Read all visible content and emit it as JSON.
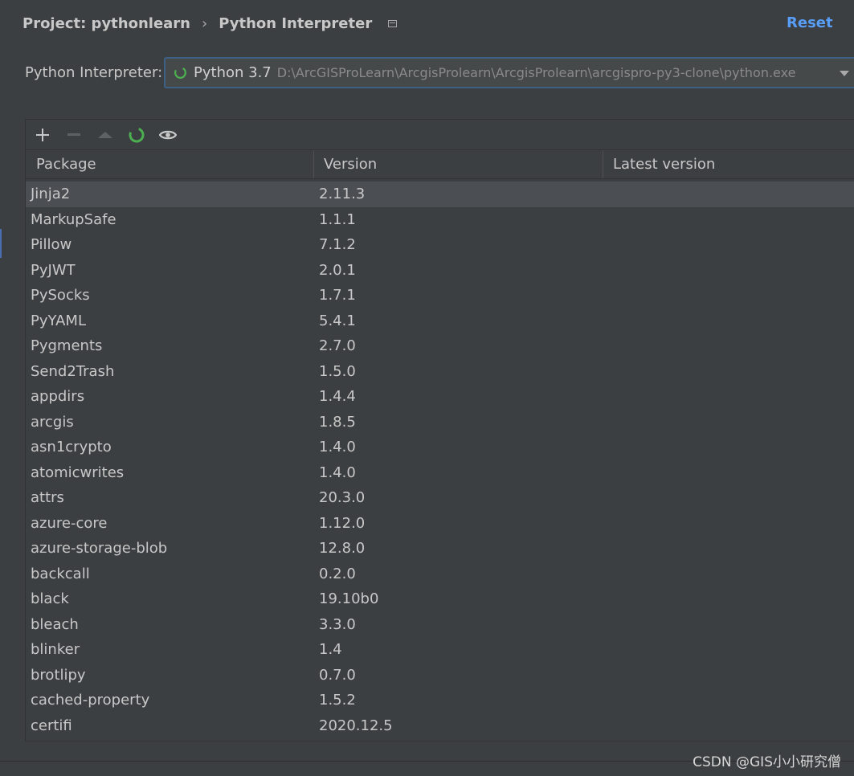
{
  "breadcrumb": {
    "project": "Project: pythonlearn",
    "separator": "›",
    "current": "Python Interpreter"
  },
  "reset_label": "Reset",
  "interpreter": {
    "label": "Python Interpreter:",
    "name": "Python 3.7",
    "path": "D:\\ArcGISProLearn\\ArcgisProlearn\\ArcgisProlearn\\arcgispro-py3-clone\\python.exe"
  },
  "toolbar": {
    "icons": [
      "plus-icon",
      "minus-icon",
      "up-icon",
      "refresh-icon",
      "eye-icon"
    ]
  },
  "table": {
    "columns": [
      "Package",
      "Version",
      "Latest version"
    ],
    "rows": [
      {
        "name": "Jinja2",
        "version": "2.11.3",
        "latest": ""
      },
      {
        "name": "MarkupSafe",
        "version": "1.1.1",
        "latest": ""
      },
      {
        "name": "Pillow",
        "version": "7.1.2",
        "latest": ""
      },
      {
        "name": "PyJWT",
        "version": "2.0.1",
        "latest": ""
      },
      {
        "name": "PySocks",
        "version": "1.7.1",
        "latest": ""
      },
      {
        "name": "PyYAML",
        "version": "5.4.1",
        "latest": ""
      },
      {
        "name": "Pygments",
        "version": "2.7.0",
        "latest": ""
      },
      {
        "name": "Send2Trash",
        "version": "1.5.0",
        "latest": ""
      },
      {
        "name": "appdirs",
        "version": "1.4.4",
        "latest": ""
      },
      {
        "name": "arcgis",
        "version": "1.8.5",
        "latest": ""
      },
      {
        "name": "asn1crypto",
        "version": "1.4.0",
        "latest": ""
      },
      {
        "name": "atomicwrites",
        "version": "1.4.0",
        "latest": ""
      },
      {
        "name": "attrs",
        "version": "20.3.0",
        "latest": ""
      },
      {
        "name": "azure-core",
        "version": "1.12.0",
        "latest": ""
      },
      {
        "name": "azure-storage-blob",
        "version": "12.8.0",
        "latest": ""
      },
      {
        "name": "backcall",
        "version": "0.2.0",
        "latest": ""
      },
      {
        "name": "black",
        "version": "19.10b0",
        "latest": ""
      },
      {
        "name": "bleach",
        "version": "3.3.0",
        "latest": ""
      },
      {
        "name": "blinker",
        "version": "1.4",
        "latest": ""
      },
      {
        "name": "brotlipy",
        "version": "0.7.0",
        "latest": ""
      },
      {
        "name": "cached-property",
        "version": "1.5.2",
        "latest": ""
      },
      {
        "name": "certifi",
        "version": "2020.12.5",
        "latest": ""
      }
    ]
  },
  "watermark": "CSDN @GIS小小研究僧",
  "colors": {
    "background": "#3c3f41",
    "accent": "#589df6",
    "spinner": "#4caf50",
    "selected_row": "#4b4e52"
  }
}
